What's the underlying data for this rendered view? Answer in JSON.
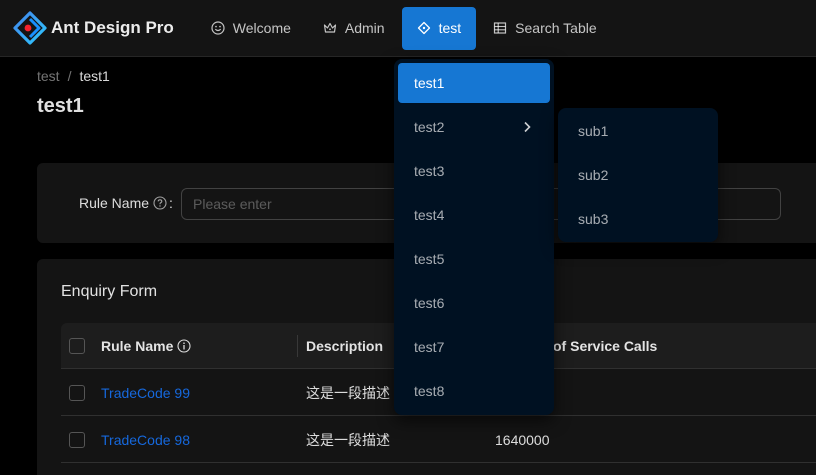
{
  "header": {
    "logo_title": "Ant Design Pro",
    "menu": [
      {
        "label": "Welcome",
        "icon": "smile-icon"
      },
      {
        "label": "Admin",
        "icon": "crown-icon"
      },
      {
        "label": "test",
        "icon": "diamond-icon",
        "active": true
      },
      {
        "label": "Search Table",
        "icon": "table-icon"
      }
    ]
  },
  "breadcrumb": {
    "parent": "test",
    "separator": "/",
    "current": "test1"
  },
  "page": {
    "title": "test1"
  },
  "search_form": {
    "rule_name_label": "Rule Name",
    "colon": ":",
    "rule_name_placeholder": "Please enter"
  },
  "table": {
    "title": "Enquiry Form",
    "columns": {
      "rule_name": "Rule Name",
      "description": "Description",
      "calls": "of Service Calls"
    },
    "rows": [
      {
        "rule_name": "TradeCode 99",
        "description": "这是一段描述",
        "calls": ""
      },
      {
        "rule_name": "TradeCode 98",
        "description": "这是一段描述",
        "calls": "1640000"
      }
    ]
  },
  "dropdown": {
    "items": [
      "test1",
      "test2",
      "test3",
      "test4",
      "test5",
      "test6",
      "test7",
      "test8"
    ],
    "active": "test1",
    "submenu_parent": "test2",
    "submenu": [
      "sub1",
      "sub2",
      "sub3"
    ]
  },
  "colors": {
    "primary": "#1677d3",
    "link": "#1668dc",
    "dropdown_bg": "#001122",
    "header_bg": "#141414"
  }
}
